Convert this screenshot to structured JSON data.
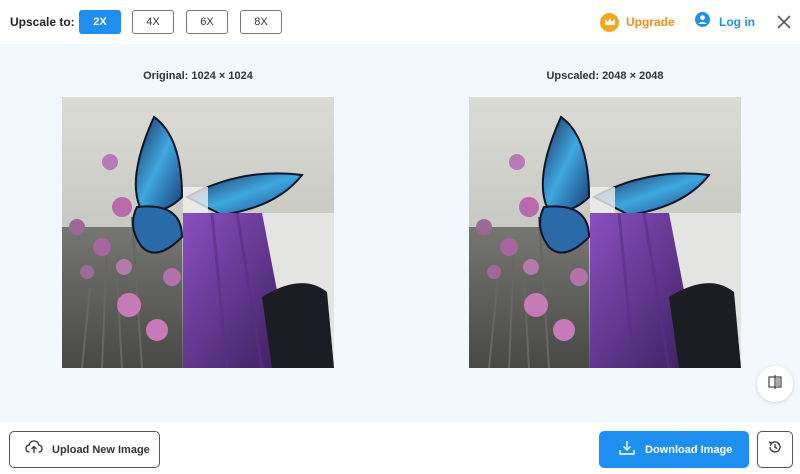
{
  "toolbar": {
    "scale_label": "Upscale to:",
    "scale_options": [
      "2X",
      "4X",
      "6X",
      "8X"
    ],
    "selected_scale": "2X",
    "upgrade_label": "Upgrade",
    "login_label": "Log in"
  },
  "preview": {
    "original_caption": "Original: 1024 × 1024",
    "upscaled_caption": "Upscaled: 2048 × 2048"
  },
  "footer": {
    "upload_label": "Upload New Image",
    "download_label": "Download Image"
  },
  "colors": {
    "accent": "#1e8ff0",
    "upgrade": "#f08c1a",
    "panel_background": "#f3f8fd"
  },
  "icons": {
    "upgrade": "crown-icon",
    "login": "user-icon",
    "close": "close-icon",
    "compare": "compare-icon",
    "upload": "cloud-upload-icon",
    "download": "download-icon",
    "history": "history-icon"
  }
}
